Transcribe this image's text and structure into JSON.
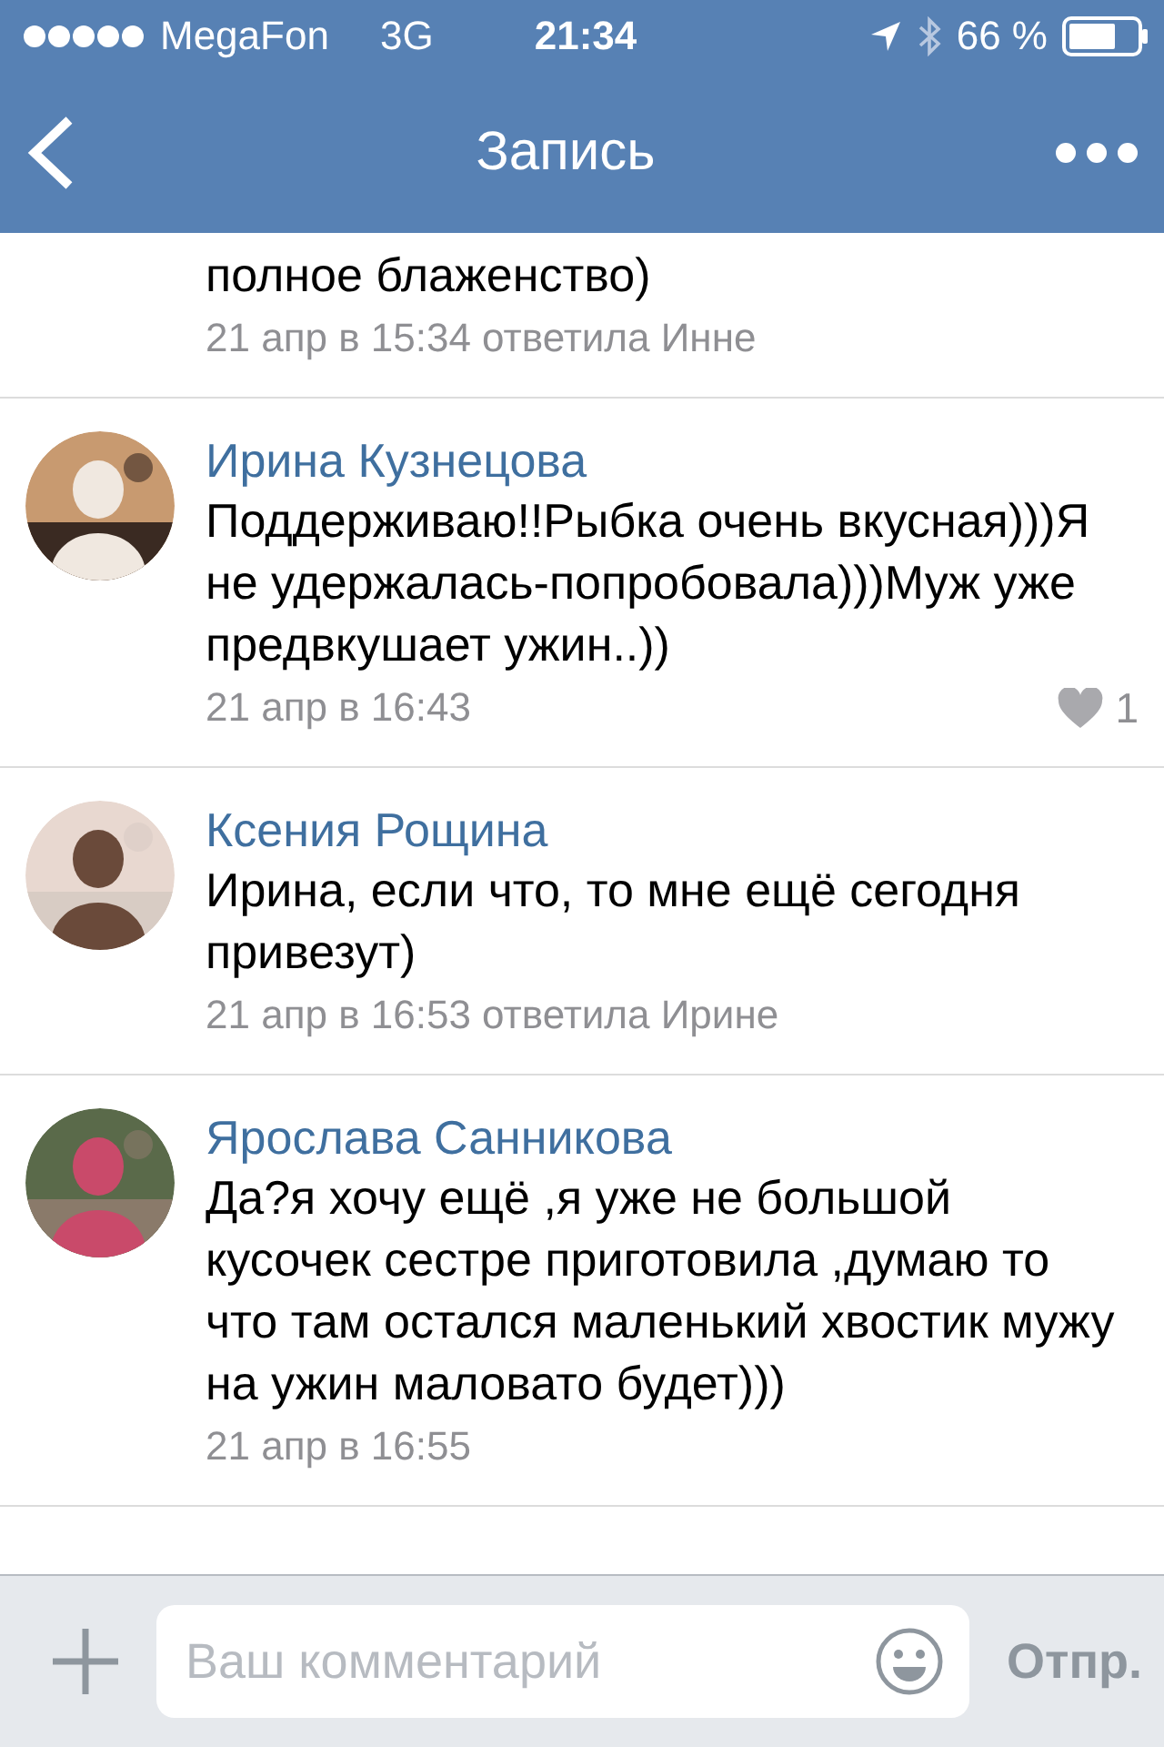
{
  "status_bar": {
    "carrier": "MegaFon",
    "network": "3G",
    "time": "21:34",
    "battery": "66 %"
  },
  "nav": {
    "title": "Запись"
  },
  "comments": [
    {
      "kind": "continuation",
      "text": "полное блаженство)",
      "meta": "21 апр в 15:34 ответила Инне"
    },
    {
      "kind": "comment",
      "author": "Ирина Кузнецова",
      "text": "Поддерживаю!!Рыбка очень вкусная)))Я не удержалась-попробовала)))Муж уже предвкушает ужин..))",
      "meta": "21 апр в 16:43",
      "likes": "1"
    },
    {
      "kind": "comment",
      "author": "Ксения Рощина",
      "text": "Ирина, если что, то мне ещё сегодня привезут)",
      "meta": "21 апр в 16:53 ответила Ирине"
    },
    {
      "kind": "comment",
      "author": "Ярослава Санникова",
      "text": "Да?я хочу ещё ,я уже не большой кусочек сестре приготовила ,думаю то что там остался маленький хвостик мужу на ужин маловато будет)))",
      "meta": "21 апр в 16:55"
    }
  ],
  "composer": {
    "placeholder": "Ваш комментарий",
    "send": "Отпр."
  }
}
